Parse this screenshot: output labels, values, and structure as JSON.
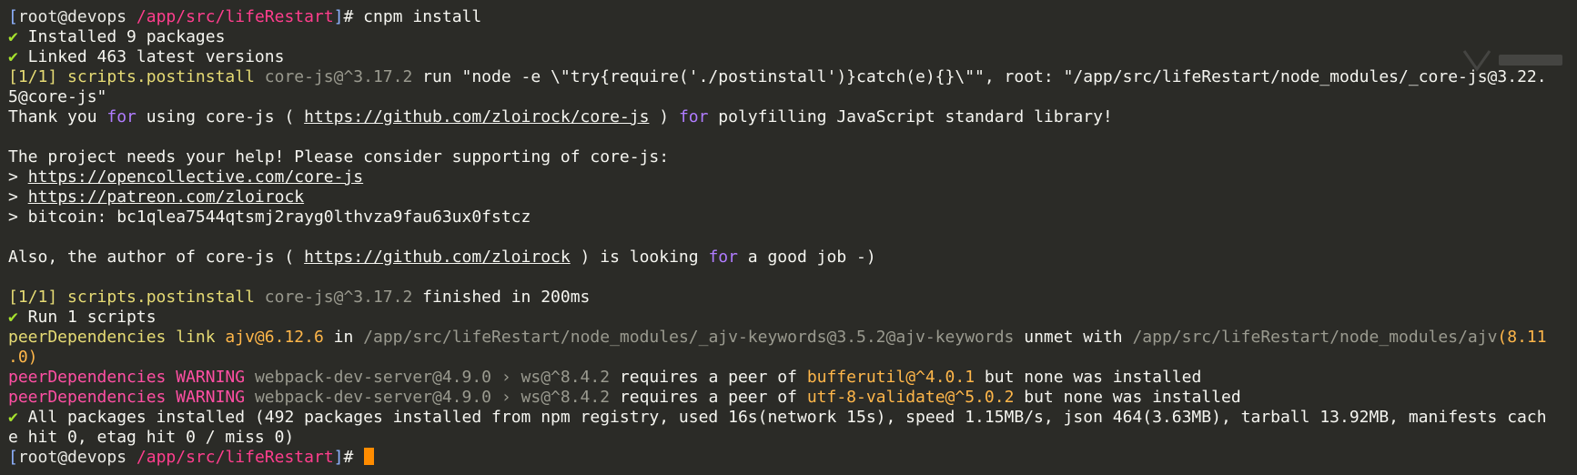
{
  "colors": {
    "background": "#2b2b27",
    "default": "#f5f5f0",
    "bracket": "#8fb3ff",
    "user": "#e9e9e4",
    "host": "#e9e9e4",
    "path": "#ff3e8d",
    "check": "#a6e22e",
    "step": "#e6db74",
    "dim": "#9a9a8f",
    "keyword": "#b07cff",
    "peer": "#e6db74",
    "warn": "#ff4fa3",
    "pkg": "#ffb74a",
    "cursor": "#ff8c00"
  },
  "terminal": {
    "lines": [
      [
        {
          "t": "[",
          "c": "bracket"
        },
        {
          "t": "root",
          "c": "user"
        },
        {
          "t": "@",
          "c": "user"
        },
        {
          "t": "devops",
          "c": "host"
        },
        {
          "t": " /app/src/lifeRestart",
          "c": "path"
        },
        {
          "t": "]",
          "c": "bracket"
        },
        {
          "t": "# cnpm install",
          "c": "default"
        }
      ],
      [
        {
          "t": "✔",
          "c": "check"
        },
        {
          "t": " Installed 9 packages",
          "c": "default"
        }
      ],
      [
        {
          "t": "✔",
          "c": "check"
        },
        {
          "t": " Linked 463 latest versions",
          "c": "default"
        }
      ],
      [
        {
          "t": "[1/1] scripts.postinstall ",
          "c": "step"
        },
        {
          "t": "core-js@^3.17.2",
          "c": "dim"
        },
        {
          "t": " run \"node -e \\\"try{require('./postinstall')}catch(e){}\\\"\", root: \"/app/src/lifeRestart/node_modules/_core-js@3.22.",
          "c": "default"
        }
      ],
      [
        {
          "t": "5@core-js\"",
          "c": "default"
        }
      ],
      [
        {
          "t": "Thank you ",
          "c": "default"
        },
        {
          "t": "for",
          "c": "keyword"
        },
        {
          "t": " using core-js ( ",
          "c": "default"
        },
        {
          "t": "https://github.com/zloirock/core-js",
          "c": "default",
          "u": true
        },
        {
          "t": " ) ",
          "c": "default"
        },
        {
          "t": "for",
          "c": "keyword"
        },
        {
          "t": " polyfilling JavaScript standard library!",
          "c": "default"
        }
      ],
      [],
      [
        {
          "t": "The project needs your help! Please consider supporting of core-js:",
          "c": "default"
        }
      ],
      [
        {
          "t": "> ",
          "c": "default"
        },
        {
          "t": "https://opencollective.com/core-js",
          "c": "default",
          "u": true
        }
      ],
      [
        {
          "t": "> ",
          "c": "default"
        },
        {
          "t": "https://patreon.com/zloirock",
          "c": "default",
          "u": true
        }
      ],
      [
        {
          "t": "> bitcoin: bc1qlea7544qtsmj2rayg0lthvza9fau63ux0fstcz",
          "c": "default"
        }
      ],
      [],
      [
        {
          "t": "Also, the author of core-js ( ",
          "c": "default"
        },
        {
          "t": "https://github.com/zloirock",
          "c": "default",
          "u": true
        },
        {
          "t": " ) is looking ",
          "c": "default"
        },
        {
          "t": "for",
          "c": "keyword"
        },
        {
          "t": " a good job -)",
          "c": "default"
        }
      ],
      [],
      [
        {
          "t": "[1/1] scripts.postinstall ",
          "c": "step"
        },
        {
          "t": "core-js@^3.17.2",
          "c": "dim"
        },
        {
          "t": " finished in 200ms",
          "c": "default"
        }
      ],
      [
        {
          "t": "✔",
          "c": "check"
        },
        {
          "t": " Run 1 scripts",
          "c": "default"
        }
      ],
      [
        {
          "t": "peerDependencies link ",
          "c": "peer"
        },
        {
          "t": "ajv@6.12.6",
          "c": "pkg"
        },
        {
          "t": " in ",
          "c": "default"
        },
        {
          "t": "/app/src/lifeRestart/node_modules/_ajv-keywords@3.5.2@ajv-keywords",
          "c": "dim"
        },
        {
          "t": " unmet with ",
          "c": "default"
        },
        {
          "t": "/app/src/lifeRestart/node_modules/ajv",
          "c": "dim"
        },
        {
          "t": "(8.11",
          "c": "pkg"
        }
      ],
      [
        {
          "t": ".0)",
          "c": "pkg"
        }
      ],
      [
        {
          "t": "peerDependencies WARNING ",
          "c": "warn"
        },
        {
          "t": "webpack-dev-server@4.9.0 › ws@^8.4.2",
          "c": "dim"
        },
        {
          "t": " requires a peer of ",
          "c": "default"
        },
        {
          "t": "bufferutil@^4.0.1",
          "c": "pkg"
        },
        {
          "t": " but none was installed",
          "c": "default"
        }
      ],
      [
        {
          "t": "peerDependencies WARNING ",
          "c": "warn"
        },
        {
          "t": "webpack-dev-server@4.9.0 › ws@^8.4.2",
          "c": "dim"
        },
        {
          "t": " requires a peer of ",
          "c": "default"
        },
        {
          "t": "utf-8-validate@^5.0.2",
          "c": "pkg"
        },
        {
          "t": " but none was installed",
          "c": "default"
        }
      ],
      [
        {
          "t": "✔",
          "c": "check"
        },
        {
          "t": " All packages installed (492 packages installed from npm registry, used 16s(network 15s), speed 1.15MB/s, json 464(3.63MB), tarball 13.92MB, manifests cach",
          "c": "default"
        }
      ],
      [
        {
          "t": "e hit 0, etag hit 0 / miss 0)",
          "c": "default"
        }
      ],
      [
        {
          "t": "[",
          "c": "bracket"
        },
        {
          "t": "root",
          "c": "user"
        },
        {
          "t": "@",
          "c": "user"
        },
        {
          "t": "devops",
          "c": "host"
        },
        {
          "t": " /app/src/lifeRestart",
          "c": "path"
        },
        {
          "t": "]",
          "c": "bracket"
        },
        {
          "t": "# ",
          "c": "default"
        }
      ]
    ]
  }
}
